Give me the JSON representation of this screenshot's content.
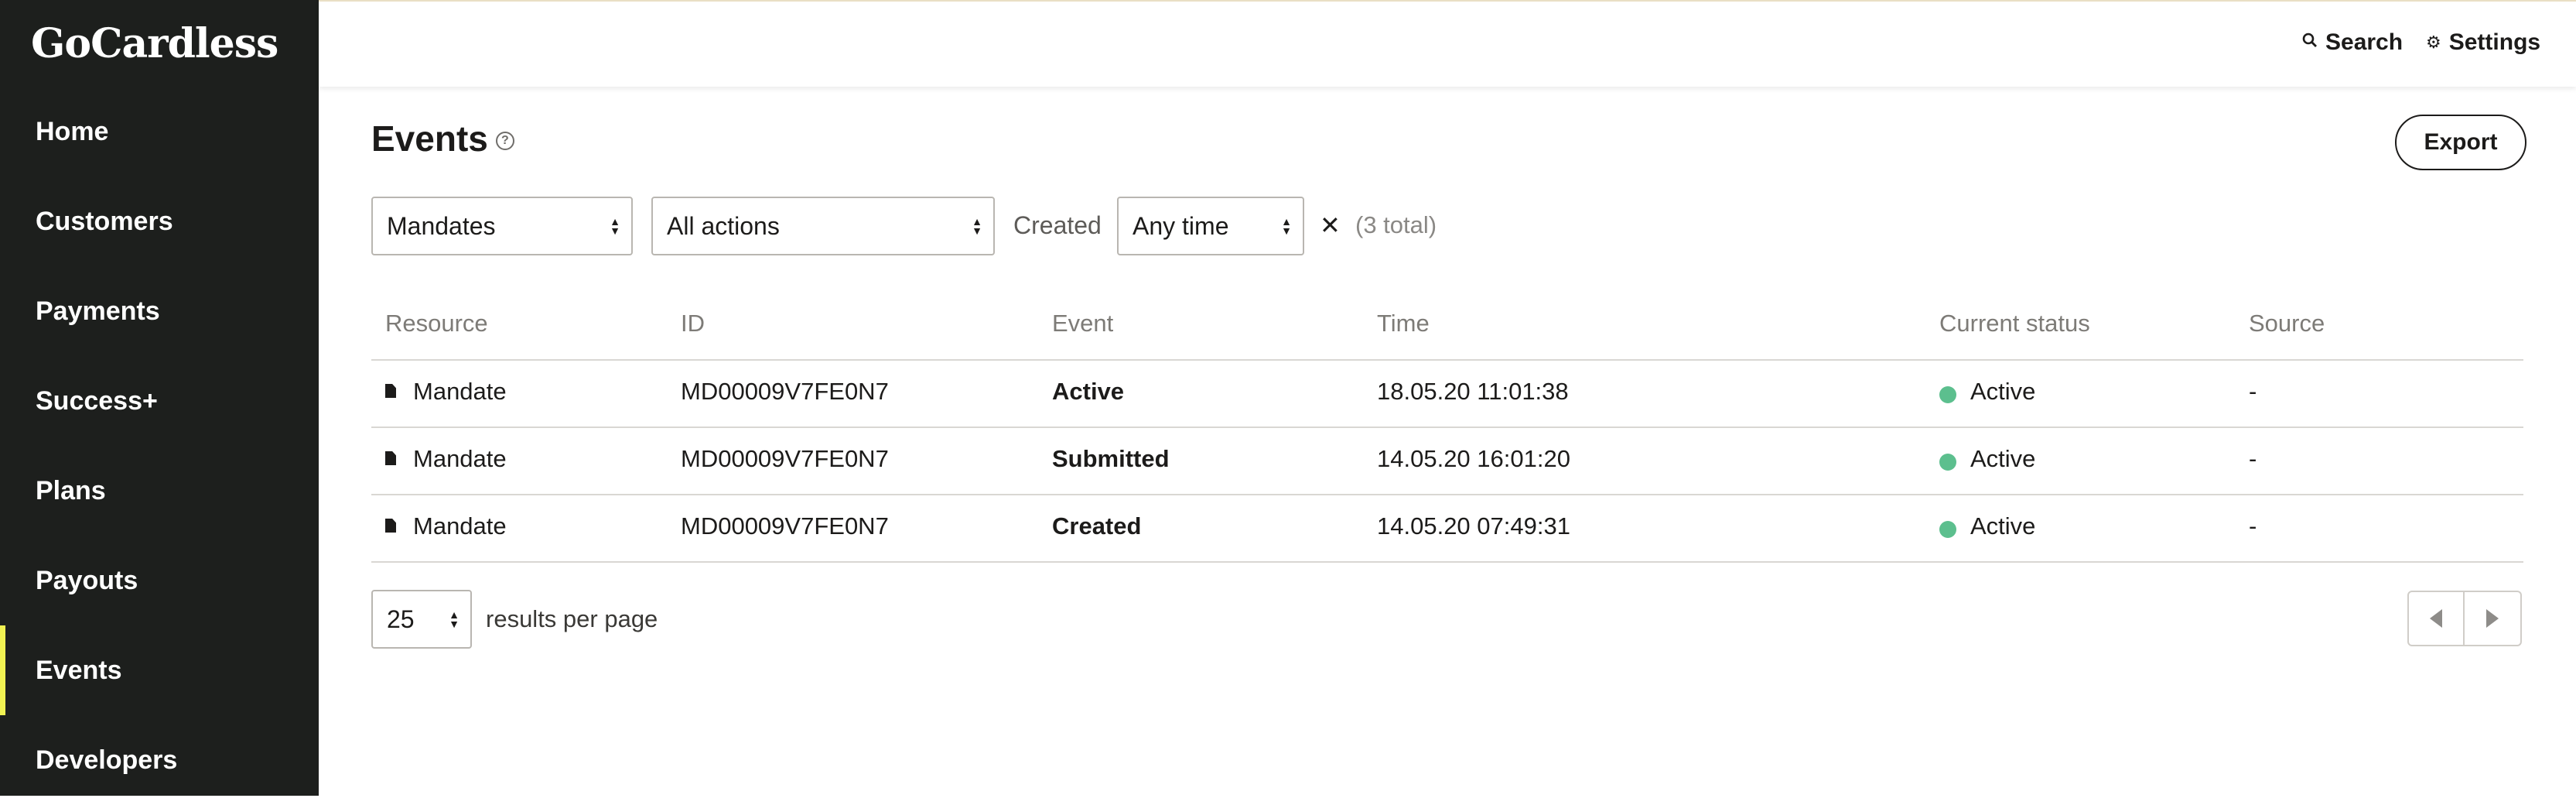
{
  "app": {
    "logo_text": "GoCardless"
  },
  "sidebar": {
    "items": [
      {
        "label": "Home"
      },
      {
        "label": "Customers"
      },
      {
        "label": "Payments"
      },
      {
        "label": "Success+"
      },
      {
        "label": "Plans"
      },
      {
        "label": "Payouts"
      },
      {
        "label": "Events",
        "active": true
      },
      {
        "label": "Developers"
      }
    ],
    "accent_color": "#f1f252"
  },
  "topbar": {
    "search_label": "Search",
    "settings_label": "Settings"
  },
  "page": {
    "title": "Events",
    "export_label": "Export"
  },
  "filters": {
    "resource_value": "Mandates",
    "action_value": "All actions",
    "created_label": "Created",
    "time_value": "Any time",
    "total_text": "(3 total)"
  },
  "table": {
    "headers": [
      "Resource",
      "ID",
      "Event",
      "Time",
      "Current status",
      "Source"
    ],
    "rows": [
      {
        "resource": "Mandate",
        "id": "MD00009V7FE0N7",
        "event": "Active",
        "time": "18.05.20 11:01:38",
        "status": "Active",
        "source": "-"
      },
      {
        "resource": "Mandate",
        "id": "MD00009V7FE0N7",
        "event": "Submitted",
        "time": "14.05.20 16:01:20",
        "status": "Active",
        "source": "-"
      },
      {
        "resource": "Mandate",
        "id": "MD00009V7FE0N7",
        "event": "Created",
        "time": "14.05.20 07:49:31",
        "status": "Active",
        "source": "-"
      }
    ],
    "status_color": "#5cbf8e"
  },
  "pagination": {
    "per_page_value": "25",
    "per_page_label": "results per page"
  }
}
